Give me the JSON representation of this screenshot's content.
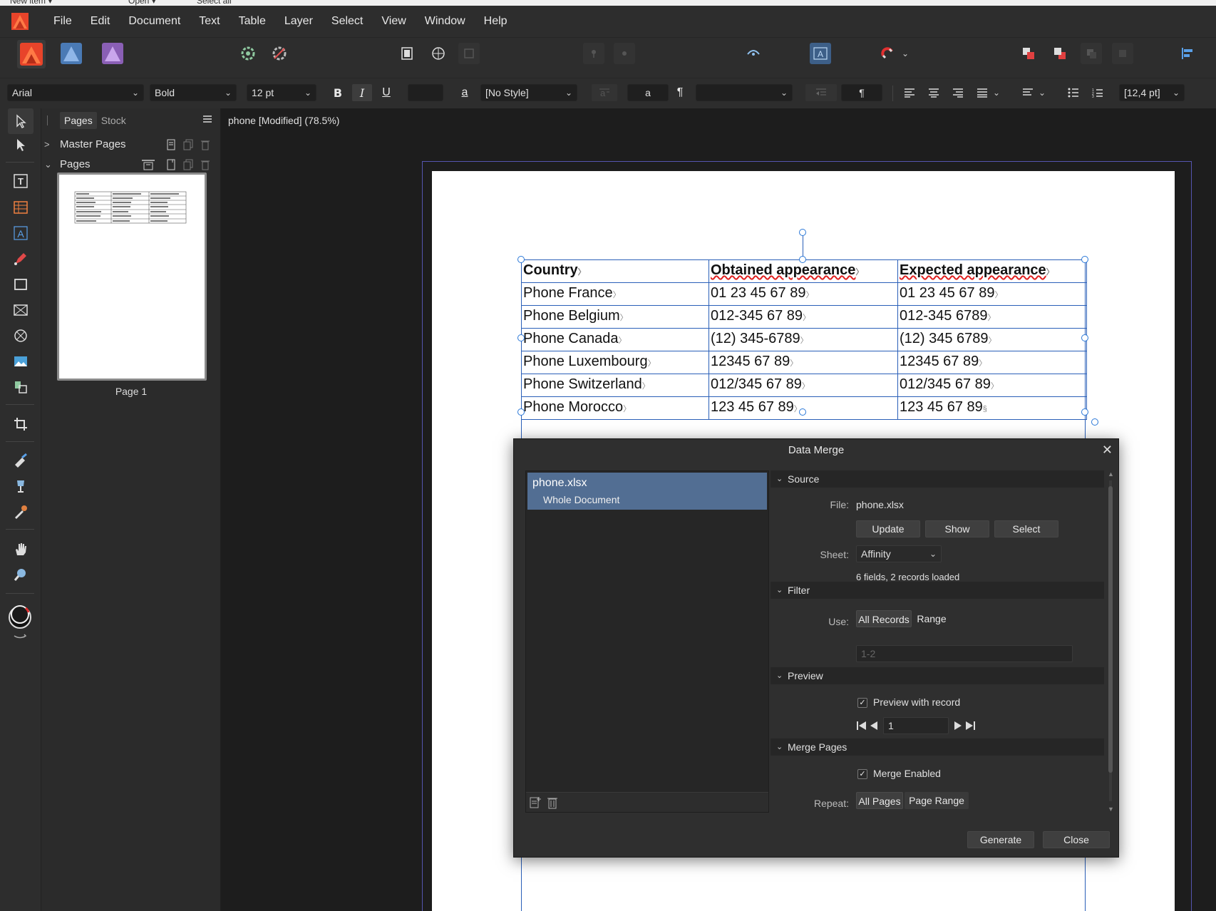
{
  "top_strip": {
    "new_item": "New item ▾",
    "open": "Open ▾",
    "select_all": "Select all"
  },
  "menu": [
    "File",
    "Edit",
    "Document",
    "Text",
    "Table",
    "Layer",
    "Select",
    "View",
    "Window",
    "Help"
  ],
  "context_bar": {
    "font_family": "Arial",
    "font_style": "Bold",
    "font_size": "12 pt",
    "bold_label": "B",
    "italic_label": "I",
    "underline_label": "U",
    "char_style_glyph": "a",
    "text_style": "[No Style]",
    "text_style_preview": "a",
    "pilcrow": "¶",
    "pilcrow_2": "¶",
    "leading": "[12,4 pt]"
  },
  "panel": {
    "tabs": [
      "Pages",
      "Stock"
    ],
    "master_pages_label": "Master Pages",
    "pages_label": "Pages",
    "page_caption": "Page 1"
  },
  "document": {
    "title": "phone [Modified] (78.5%)",
    "table": {
      "headers": [
        "Country",
        "Obtained appearance",
        "Expected appearance"
      ],
      "rows": [
        [
          "Phone France",
          "01 23 45 67 89",
          "01 23 45 67 89"
        ],
        [
          "Phone Belgium",
          "012-345 67 89",
          "012-345 6789"
        ],
        [
          "Phone Canada",
          "(12) 345-6789",
          "(12) 345 6789"
        ],
        [
          "Phone Luxembourg",
          "12345 67 89",
          "12345 67 89"
        ],
        [
          "Phone Switzerland",
          "012/345 67 89",
          "012/345 67 89"
        ],
        [
          "Phone Morocco",
          "123 45 67 89",
          "123 45 67 89"
        ]
      ]
    }
  },
  "data_merge": {
    "title": "Data Merge",
    "source_item": {
      "name": "phone.xlsx",
      "scope": "Whole Document"
    },
    "source_section": "Source",
    "file_label": "File:",
    "file_value": "phone.xlsx",
    "update_button": "Update",
    "show_button": "Show",
    "select_button": "Select",
    "sheet_label": "Sheet:",
    "sheet_value": "Affinity",
    "records_status": "6 fields, 2 records loaded",
    "filter_section": "Filter",
    "use_label": "Use:",
    "use_options": [
      "All Records",
      "Range"
    ],
    "range_placeholder": "1-2",
    "preview_section": "Preview",
    "preview_checkbox": "Preview with record",
    "preview_checked": true,
    "record_number": "1",
    "merge_section": "Merge Pages",
    "merge_checkbox": "Merge Enabled",
    "merge_checked": true,
    "repeat_label": "Repeat:",
    "repeat_options": [
      "All Pages",
      "Page Range"
    ],
    "generate_button": "Generate",
    "close_button": "Close"
  },
  "colors": {
    "accent_selection": "#526e93",
    "table_border": "#2a5fb8",
    "spell_underline": "#e02020",
    "app_logo": "#e8442a"
  }
}
